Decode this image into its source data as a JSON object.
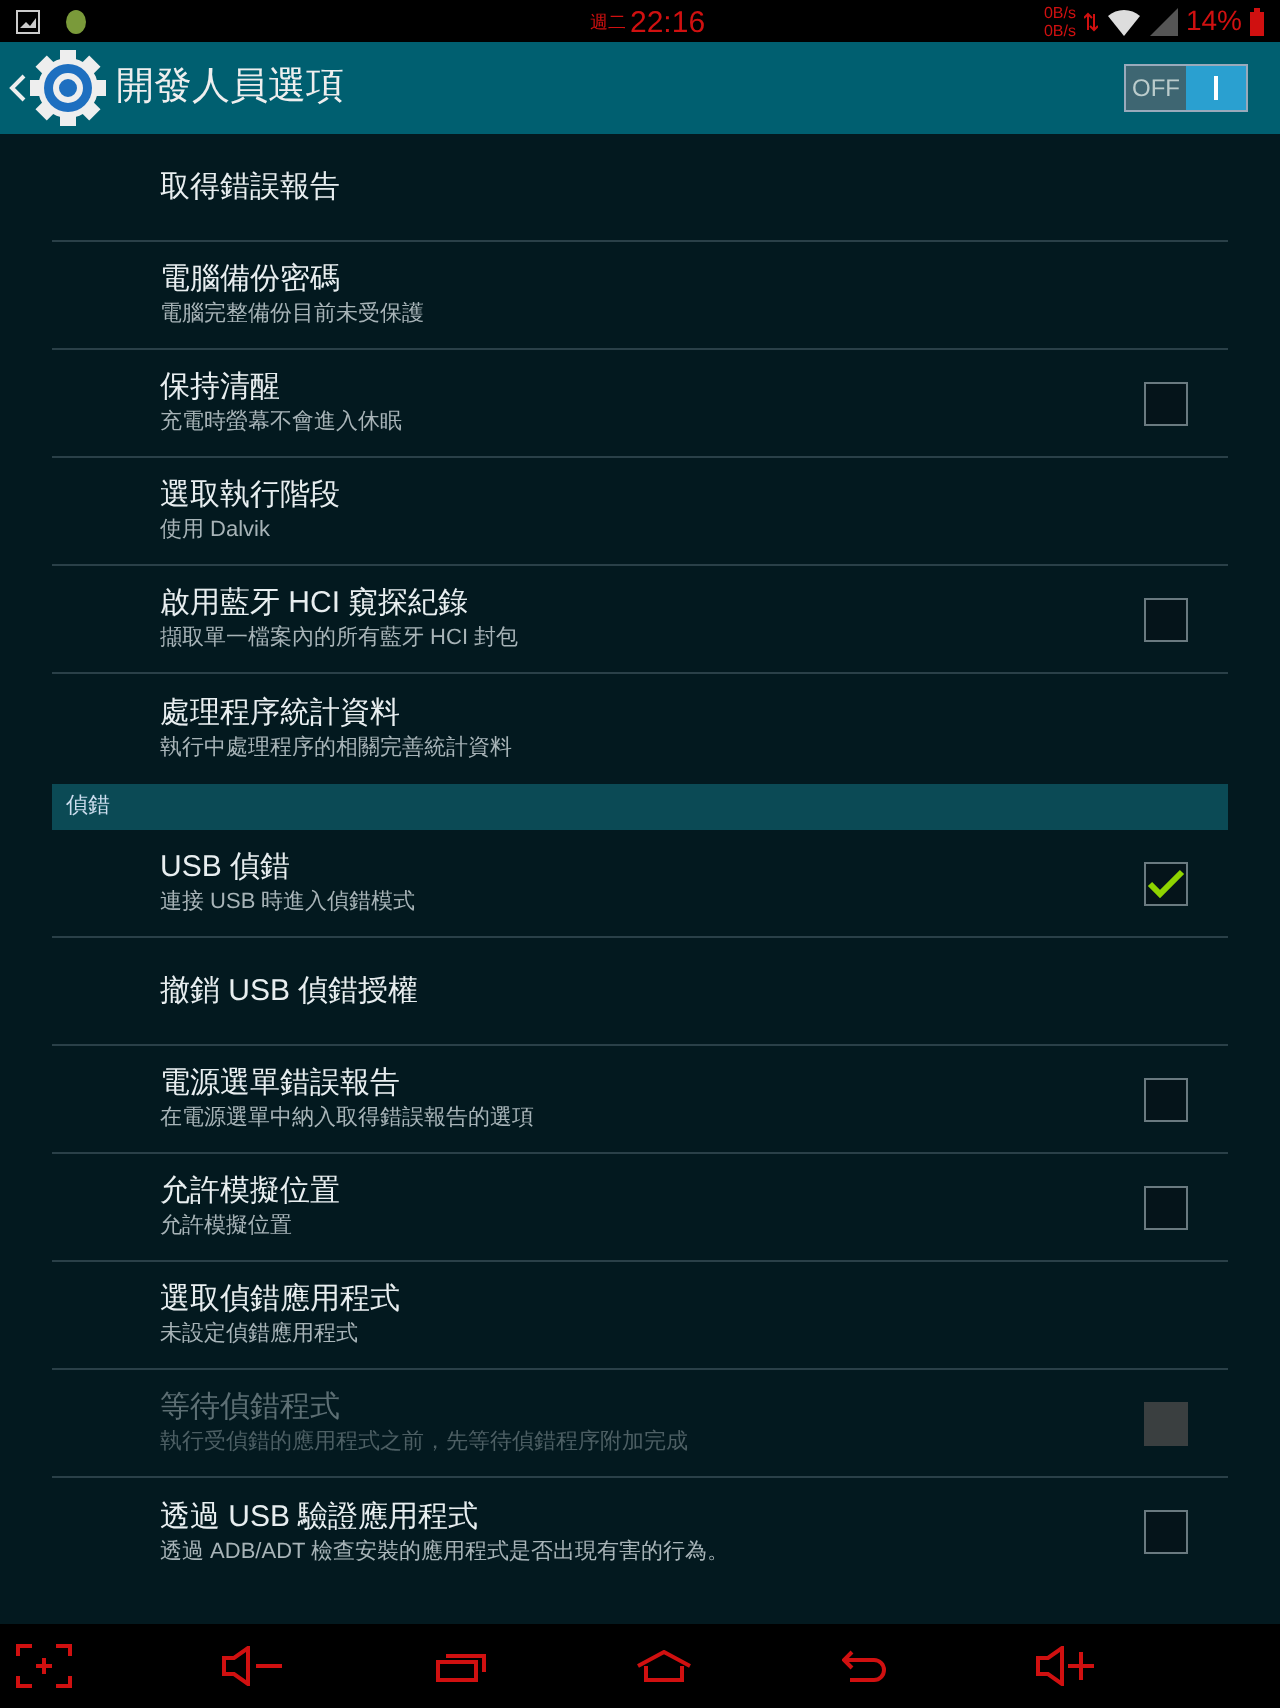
{
  "status_bar": {
    "weekday": "週二",
    "time": "22:16",
    "upload_rate": "0B/s",
    "download_rate": "0B/s",
    "battery": "14%"
  },
  "app_bar": {
    "title": "開發人員選項",
    "toggle": {
      "label": "OFF",
      "on": false
    }
  },
  "settings": [
    {
      "kind": "item",
      "title": "取得錯誤報告"
    },
    {
      "kind": "item",
      "title": "電腦備份密碼",
      "summary": "電腦完整備份目前未受保護"
    },
    {
      "kind": "checkbox",
      "title": "保持清醒",
      "summary": "充電時螢幕不會進入休眠",
      "checked": false,
      "disabled": false
    },
    {
      "kind": "item",
      "title": "選取執行階段",
      "summary": "使用 Dalvik"
    },
    {
      "kind": "checkbox",
      "title": "啟用藍牙 HCI 窺探紀錄",
      "summary": "擷取單一檔案內的所有藍牙 HCI 封包",
      "checked": false,
      "disabled": false
    },
    {
      "kind": "item",
      "title": "處理程序統計資料",
      "summary": "執行中處理程序的相關完善統計資料"
    },
    {
      "kind": "category",
      "title": "偵錯"
    },
    {
      "kind": "checkbox",
      "title": "USB 偵錯",
      "summary": "連接 USB 時進入偵錯模式",
      "checked": true,
      "disabled": false
    },
    {
      "kind": "item",
      "title": "撤銷 USB 偵錯授權"
    },
    {
      "kind": "checkbox",
      "title": "電源選單錯誤報告",
      "summary": "在電源選單中納入取得錯誤報告的選項",
      "checked": false,
      "disabled": false
    },
    {
      "kind": "checkbox",
      "title": "允許模擬位置",
      "summary": "允許模擬位置",
      "checked": false,
      "disabled": false
    },
    {
      "kind": "item",
      "title": "選取偵錯應用程式",
      "summary": "未設定偵錯應用程式"
    },
    {
      "kind": "checkbox",
      "title": "等待偵錯程式",
      "summary": "執行受偵錯的應用程式之前，先等待偵錯程序附加完成",
      "checked": false,
      "disabled": true
    },
    {
      "kind": "checkbox",
      "title": "透過 USB 驗證應用程式",
      "summary": "透過 ADB/ADT 檢查安裝的應用程式是否出現有害的行為。",
      "checked": false,
      "disabled": false
    }
  ]
}
